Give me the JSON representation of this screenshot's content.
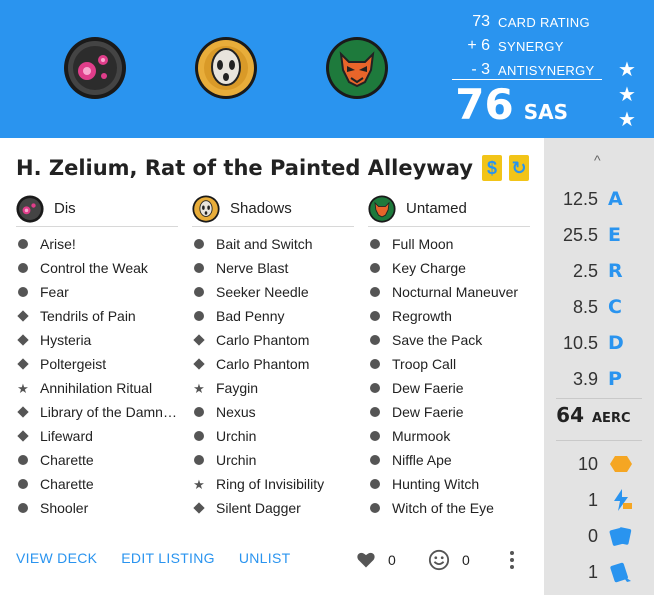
{
  "header": {
    "houses": [
      "Dis",
      "Shadows",
      "Untamed"
    ],
    "card_rating_value": "73",
    "card_rating_label": "CARD RATING",
    "synergy_value": "+ 6",
    "synergy_label": "SYNERGY",
    "antisynergy_value": "- 3",
    "antisynergy_label": "ANTISYNERGY",
    "sas_value": "76",
    "sas_label": "SAS",
    "stars": [
      "★",
      "★",
      "★"
    ]
  },
  "deck": {
    "name": "H. Zelium, Rat of the Painted Alleyway",
    "badges": [
      "$",
      "↻"
    ]
  },
  "columns": [
    {
      "house": "Dis",
      "cards": [
        {
          "name": "Arise!",
          "type": "action"
        },
        {
          "name": "Control the Weak",
          "type": "action"
        },
        {
          "name": "Fear",
          "type": "action"
        },
        {
          "name": "Tendrils of Pain",
          "type": "upgrade"
        },
        {
          "name": "Hysteria",
          "type": "upgrade"
        },
        {
          "name": "Poltergeist",
          "type": "upgrade"
        },
        {
          "name": "Annihilation Ritual",
          "type": "rare"
        },
        {
          "name": "Library of the Damn…",
          "type": "upgrade"
        },
        {
          "name": "Lifeward",
          "type": "upgrade"
        },
        {
          "name": "Charette",
          "type": "action"
        },
        {
          "name": "Charette",
          "type": "action"
        },
        {
          "name": "Shooler",
          "type": "action"
        }
      ]
    },
    {
      "house": "Shadows",
      "cards": [
        {
          "name": "Bait and Switch",
          "type": "action"
        },
        {
          "name": "Nerve Blast",
          "type": "action"
        },
        {
          "name": "Seeker Needle",
          "type": "action"
        },
        {
          "name": "Bad Penny",
          "type": "action"
        },
        {
          "name": "Carlo Phantom",
          "type": "upgrade"
        },
        {
          "name": "Carlo Phantom",
          "type": "upgrade"
        },
        {
          "name": "Faygin",
          "type": "rare"
        },
        {
          "name": "Nexus",
          "type": "action"
        },
        {
          "name": "Urchin",
          "type": "action"
        },
        {
          "name": "Urchin",
          "type": "action"
        },
        {
          "name": "Ring of Invisibility",
          "type": "rare"
        },
        {
          "name": "Silent Dagger",
          "type": "upgrade"
        }
      ]
    },
    {
      "house": "Untamed",
      "cards": [
        {
          "name": "Full Moon",
          "type": "action"
        },
        {
          "name": "Key Charge",
          "type": "action"
        },
        {
          "name": "Nocturnal Maneuver",
          "type": "action"
        },
        {
          "name": "Regrowth",
          "type": "action"
        },
        {
          "name": "Save the Pack",
          "type": "action"
        },
        {
          "name": "Troop Call",
          "type": "action"
        },
        {
          "name": "Dew Faerie",
          "type": "action"
        },
        {
          "name": "Dew Faerie",
          "type": "action"
        },
        {
          "name": "Murmook",
          "type": "action"
        },
        {
          "name": "Niffle Ape",
          "type": "action"
        },
        {
          "name": "Hunting Witch",
          "type": "action"
        },
        {
          "name": "Witch of the Eye",
          "type": "action"
        }
      ]
    }
  ],
  "actions": {
    "view_deck": "VIEW DECK",
    "edit_listing": "EDIT LISTING",
    "unlist": "UNLIST",
    "likes": "0",
    "funnies": "0"
  },
  "stats": {
    "collapse": "^",
    "rows": [
      {
        "value": "12.5",
        "letter": "A"
      },
      {
        "value": "25.5",
        "letter": "E"
      },
      {
        "value": "2.5",
        "letter": "R"
      },
      {
        "value": "8.5",
        "letter": "C"
      },
      {
        "value": "10.5",
        "letter": "D"
      },
      {
        "value": "3.9",
        "letter": "P"
      }
    ],
    "aerc_value": "64",
    "aerc_label": "AERC",
    "icon_rows": [
      {
        "value": "10",
        "icon": "aember-icon"
      },
      {
        "value": "1",
        "icon": "lightning-icon"
      },
      {
        "value": "0",
        "icon": "cards-icon"
      },
      {
        "value": "1",
        "icon": "cards-arrow-icon"
      }
    ]
  },
  "colors": {
    "accent": "#2a94ef",
    "badge": "#f2c418",
    "dis": "#c2387c",
    "shadows": "#e8ad3a",
    "untamed": "#1e7a3c",
    "aember": "#f5a623"
  }
}
